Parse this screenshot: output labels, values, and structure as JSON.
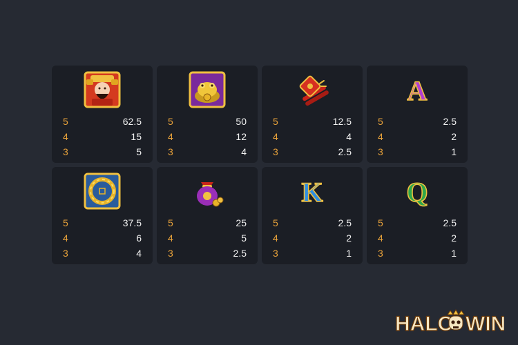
{
  "paytable": [
    {
      "symbol": "god-of-wealth-icon",
      "rows": [
        {
          "count": "5",
          "value": "62.5"
        },
        {
          "count": "4",
          "value": "15"
        },
        {
          "count": "3",
          "value": "5"
        }
      ]
    },
    {
      "symbol": "golden-toad-icon",
      "rows": [
        {
          "count": "5",
          "value": "50"
        },
        {
          "count": "4",
          "value": "12"
        },
        {
          "count": "3",
          "value": "4"
        }
      ]
    },
    {
      "symbol": "firecracker-icon",
      "rows": [
        {
          "count": "5",
          "value": "12.5"
        },
        {
          "count": "4",
          "value": "4"
        },
        {
          "count": "3",
          "value": "2.5"
        }
      ]
    },
    {
      "symbol": "letter-a-icon",
      "rows": [
        {
          "count": "5",
          "value": "2.5"
        },
        {
          "count": "4",
          "value": "2"
        },
        {
          "count": "3",
          "value": "1"
        }
      ]
    },
    {
      "symbol": "coin-tile-icon",
      "rows": [
        {
          "count": "5",
          "value": "37.5"
        },
        {
          "count": "4",
          "value": "6"
        },
        {
          "count": "3",
          "value": "4"
        }
      ]
    },
    {
      "symbol": "money-bag-icon",
      "rows": [
        {
          "count": "5",
          "value": "25"
        },
        {
          "count": "4",
          "value": "5"
        },
        {
          "count": "3",
          "value": "2.5"
        }
      ]
    },
    {
      "symbol": "letter-k-icon",
      "rows": [
        {
          "count": "5",
          "value": "2.5"
        },
        {
          "count": "4",
          "value": "2"
        },
        {
          "count": "3",
          "value": "1"
        }
      ]
    },
    {
      "symbol": "letter-q-icon",
      "rows": [
        {
          "count": "5",
          "value": "2.5"
        },
        {
          "count": "4",
          "value": "2"
        },
        {
          "count": "3",
          "value": "1"
        }
      ]
    }
  ],
  "letters": {
    "a": "A",
    "k": "K",
    "q": "Q"
  },
  "logo": {
    "left": "HALO",
    "right": "WIN"
  },
  "colors": {
    "background": "#262a33",
    "card": "#1b1e25",
    "count": "#e8a23a",
    "multiplier": "#f2f2f2"
  }
}
